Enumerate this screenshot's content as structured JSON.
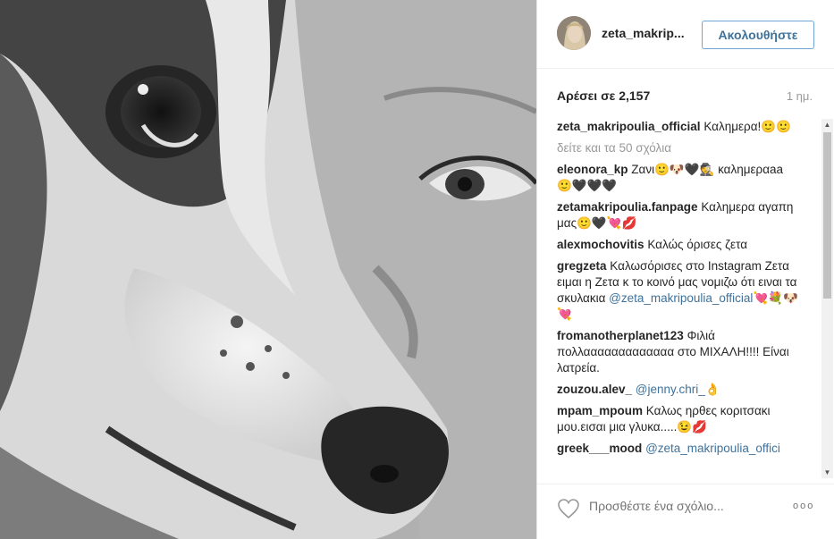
{
  "header": {
    "username": "zeta_makrip...",
    "follow_label": "Ακολουθήστε"
  },
  "stats": {
    "likes": "Αρέσει σε 2,157",
    "age": "1 ημ."
  },
  "caption": {
    "user": "zeta_makripoulia_official",
    "text": "Καλημερα!🙂🙂"
  },
  "view_all": "δείτε και τα 50 σχόλια",
  "comments": [
    {
      "user": "eleonora_kp",
      "text": "Ζανι🙂🐶🖤🕵 καλημεραaa 🙂🖤🖤🖤"
    },
    {
      "user": "zetamakripoulia.fanpage",
      "text": "Καλημερα αγαπη μας🙂🖤💘💋"
    },
    {
      "user": "alexmochovitis",
      "text": "Καλώς όρισες ζετα"
    },
    {
      "user": "gregzeta",
      "text": "Καλωσόρισες στο Instagram Ζετα ειμαι η Ζετα κ το κοινό μας νομιζω ότι ειναι τα σκυλακια",
      "mention": "@zeta_makripoulia_official",
      "after": "💘💐🐶💘"
    },
    {
      "user": "fromanotherplanet123",
      "text": "Φιλιά πολλααααααααααααα στο ΜΙΧΑΛΗ!!!! Είναι λατρεία."
    },
    {
      "user": "zouzou.alev_",
      "text": "",
      "mention": "@jenny.chri_",
      "after": "👌"
    },
    {
      "user": "mpam_mpoum",
      "text": "Καλως ηρθες κοριτσακι μου.εισαι μια γλυκα.....😉💋"
    },
    {
      "user": "greek___mood",
      "text": "",
      "mention": "@zeta_makripoulia_offici",
      "after": ""
    }
  ],
  "footer": {
    "placeholder": "Προσθέστε ένα σχόλιο...",
    "more_label": "ooo"
  }
}
